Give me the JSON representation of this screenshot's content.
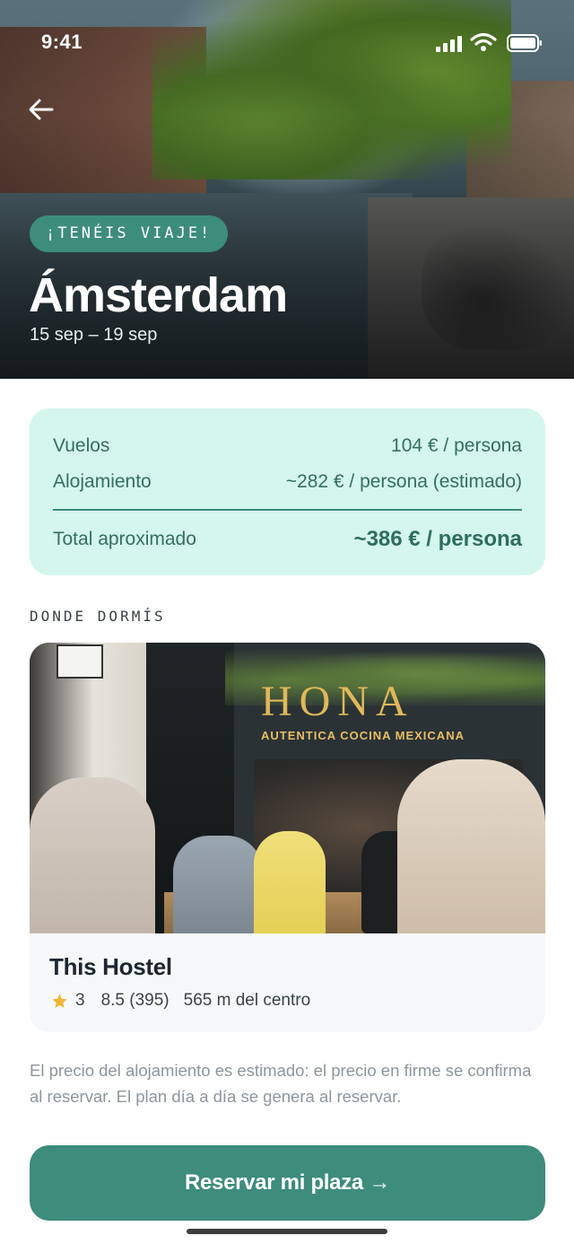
{
  "status_bar": {
    "time": "9:41"
  },
  "hero": {
    "badge": "¡TENÉIS VIAJE!",
    "city": "Ámsterdam",
    "dates": "15 sep – 19 sep"
  },
  "price_card": {
    "rows": [
      {
        "label": "Vuelos",
        "value": "104 € / persona"
      },
      {
        "label": "Alojamiento",
        "value": "~282 € / persona (estimado)"
      }
    ],
    "total": {
      "label": "Total aproximado",
      "value": "~386 € / persona"
    }
  },
  "accommodation": {
    "section_label": "DONDE DORMÍS",
    "photo_sign": "HONA",
    "photo_subsign": "AUTENTICA COCINA MEXICANA",
    "name": "This Hostel",
    "stars": "3",
    "rating": "8.5 (395)",
    "distance": "565 m del centro"
  },
  "disclaimer": "El precio del alojamiento es estimado: el precio en firme se confirma al reservar. El plan día a día se genera al reservar.",
  "cta": {
    "label": "Reservar mi plaza →"
  },
  "colors": {
    "accent": "#3d8c7c",
    "price_card_bg": "#d4f6ec",
    "star": "#f2b533"
  }
}
